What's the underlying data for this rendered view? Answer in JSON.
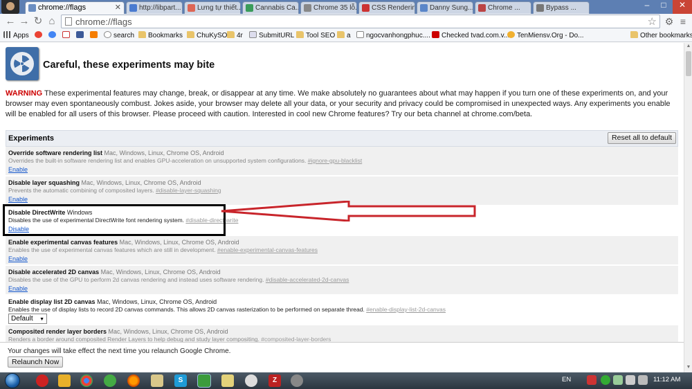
{
  "tabs": [
    {
      "label": "chrome://flags",
      "active": true
    },
    {
      "label": "http://libpart...",
      "active": false
    },
    {
      "label": "Lưng tự thiết...",
      "active": false
    },
    {
      "label": "Cannabis Ca...",
      "active": false
    },
    {
      "label": "Chrome 35 lỗ...",
      "active": false
    },
    {
      "label": "CSS Rendering",
      "active": false
    },
    {
      "label": "Danny Sung...",
      "active": false
    },
    {
      "label": "Chrome ...",
      "active": false
    },
    {
      "label": "Bypass ...",
      "active": false
    }
  ],
  "toolbar": {
    "url": "chrome://flags"
  },
  "bookmarks": {
    "items": [
      "Apps",
      "search",
      "Bookmarks",
      "ChuKySO",
      "4r",
      "SubmitURL",
      "Tool SEO",
      "a",
      "ngocvanhongphuc....",
      "Checked tvad.com.v...",
      "TenMiensv.Org - Do..."
    ],
    "other": "Other bookmarks"
  },
  "page": {
    "title": "Careful, these experiments may bite",
    "warning_label": "WARNING",
    "warning_text": " These experimental features may change, break, or disappear at any time. We make absolutely no guarantees about what may happen if you turn one of these experiments on, and your browser may even spontaneously combust. Jokes aside, your browser may delete all your data, or your security and privacy could be compromised in unexpected ways. Any experiments you enable will be enabled for all users of this browser. Please proceed with caution. Interested in cool new Chrome features? Try our beta channel at chrome.com/beta.",
    "experiments_label": "Experiments",
    "reset_label": "Reset all to default"
  },
  "experiments": [
    {
      "name": "Override software rendering list",
      "platforms": " Mac, Windows, Linux, Chrome OS, Android",
      "desc": "Overrides the built-in software rendering list and enables GPU-acceleration on unsupported system configurations. ",
      "hash": "#ignore-gpu-blacklist",
      "action": "Enable"
    },
    {
      "name": "Disable layer squashing",
      "platforms": " Mac, Windows, Linux, Chrome OS, Android",
      "desc": "Prevents the automatic combining of composited layers. ",
      "hash": "#disable-layer-squashing",
      "action": "Enable"
    },
    {
      "name": "Disable DirectWrite",
      "platforms": " Windows",
      "desc": "Disables the use of experimental DirectWrite font rendering system. ",
      "hash": "#disable-direct-write",
      "action": "Disable"
    },
    {
      "name": "Enable experimental canvas features",
      "platforms": " Mac, Windows, Linux, Chrome OS, Android",
      "desc": "Enables the use of experimental canvas features which are still in development. ",
      "hash": "#enable-experimental-canvas-features",
      "action": "Enable"
    },
    {
      "name": "Disable accelerated 2D canvas",
      "platforms": " Mac, Windows, Linux, Chrome OS, Android",
      "desc": "Disables the use of the GPU to perform 2d canvas rendering and instead uses software rendering. ",
      "hash": "#disable-accelerated-2d-canvas",
      "action": "Enable"
    },
    {
      "name": "Enable display list 2D canvas",
      "platforms": " Mac, Windows, Linux, Chrome OS, Android",
      "desc": "Enables the use of display lists to record 2D canvas commands. This allows 2D canvas rasterization to be performed on separate thread. ",
      "hash": "#enable-display-list-2d-canvas",
      "select": "Default"
    },
    {
      "name": "Composited render layer borders",
      "platforms": " Mac, Windows, Linux, Chrome OS, Android",
      "desc": "Renders a border around composited Render Layers to help debug and study layer compositing. ",
      "hash": "#composited-layer-borders"
    }
  ],
  "footer": {
    "message": "Your changes will take effect the next time you relaunch Google Chrome.",
    "relaunch_label": "Relaunch Now"
  },
  "taskbar": {
    "lang": "EN",
    "time": "11:12 AM"
  }
}
